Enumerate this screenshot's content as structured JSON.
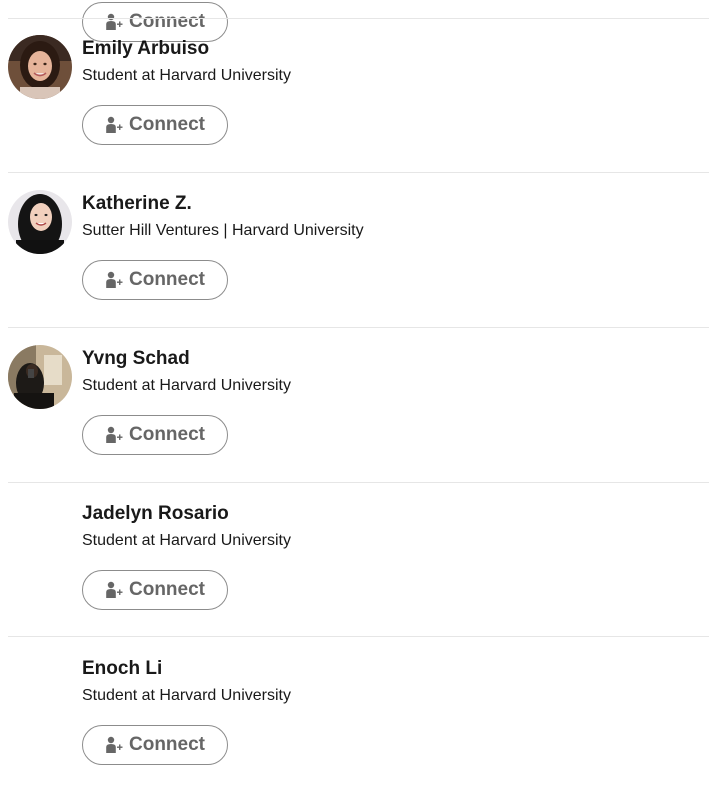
{
  "connect_label": "Connect",
  "colors": {
    "button_text": "#666666",
    "button_border": "#8c8c8c",
    "divider": "#e6e6e6"
  },
  "people": [
    {
      "name": "Emily Arbuiso",
      "headline": "Student at Harvard University",
      "has_photo": true
    },
    {
      "name": "Katherine Z.",
      "headline": "Sutter Hill Ventures | Harvard University",
      "has_photo": true
    },
    {
      "name": "Yvng Schad",
      "headline": "Student at Harvard University",
      "has_photo": true
    },
    {
      "name": "Jadelyn Rosario",
      "headline": "Student at Harvard University",
      "has_photo": false
    },
    {
      "name": "Enoch Li",
      "headline": "Student at Harvard University",
      "has_photo": false
    }
  ]
}
